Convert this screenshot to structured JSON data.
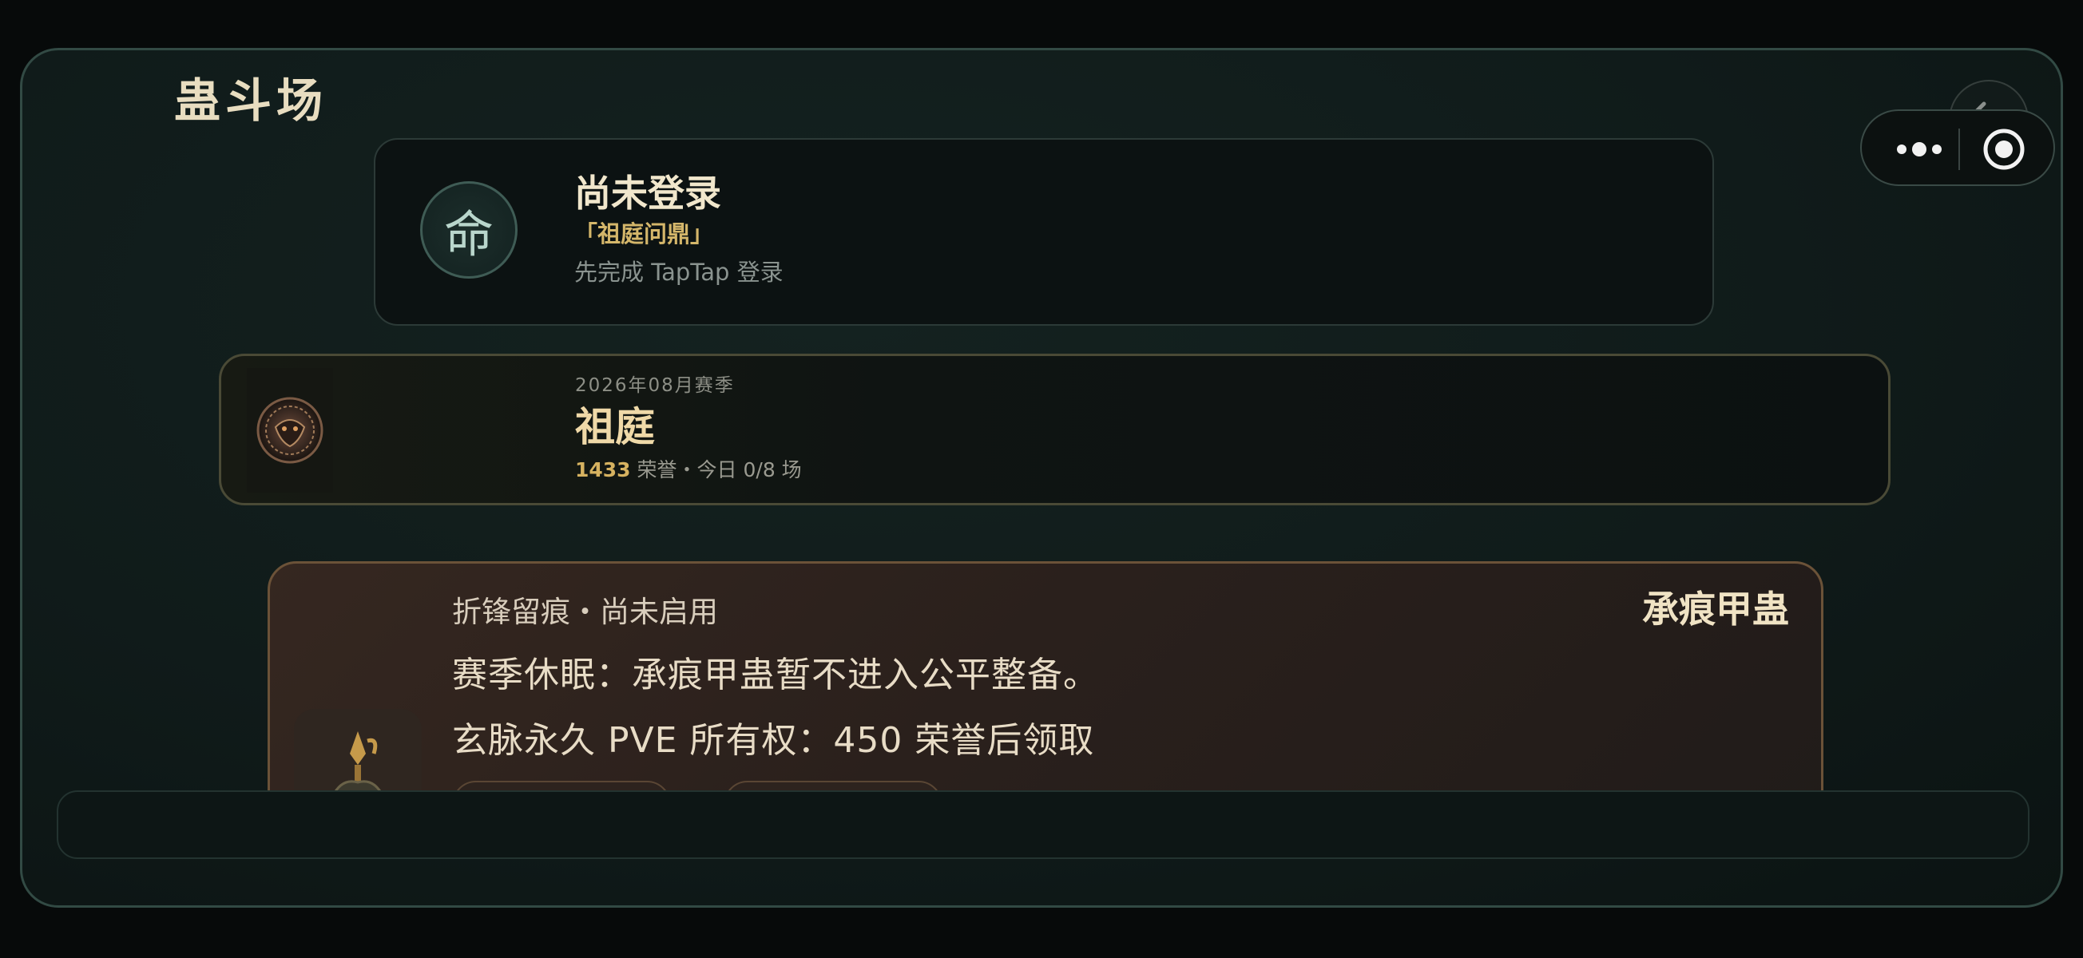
{
  "page": {
    "title": "蛊斗场"
  },
  "login_card": {
    "seal_char": "命",
    "title": "尚未登录",
    "subtitle": "「祖庭问鼎」",
    "hint": "先完成 TapTap 登录"
  },
  "season_card": {
    "season_label": "2026年08月赛季",
    "name": "祖庭",
    "honor_value": "1433",
    "stats_text": " 荣誉・今日 0/8 场"
  },
  "relic_card": {
    "status": "折锋留痕・尚未启用",
    "name": "承痕甲蛊",
    "line1": "赛季休眠：承痕甲蛊暂不进入公平整备。",
    "line2": "玄脉永久 PVE 所有权：450 荣誉后领取"
  },
  "system_capsule": {
    "more_icon": "more-dots-icon",
    "close_icon": "target-circle-icon",
    "back_icon": "back-arrow-icon"
  },
  "colors": {
    "accent_gold": "#d6b260",
    "title_cream": "#e8ddc0",
    "panel_border": "#324a44"
  }
}
